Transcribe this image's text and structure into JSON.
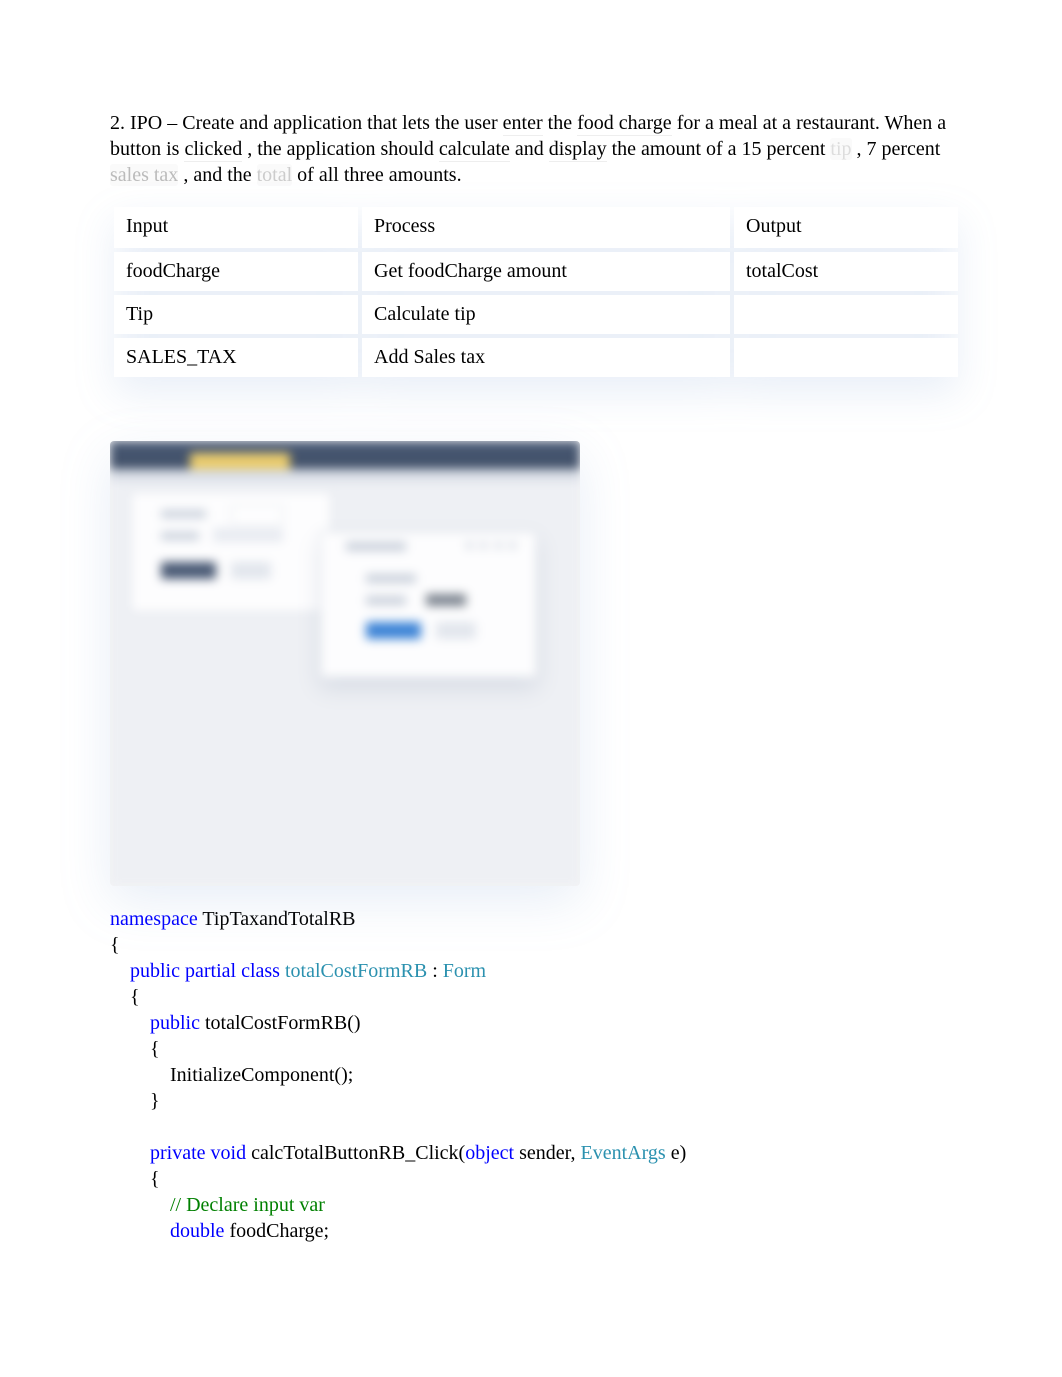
{
  "problem": {
    "prefix": "2. IPO – Create and application that lets the user ",
    "enter": "enter",
    "mid1": " the ",
    "foodcharge": "food charge",
    "mid2": " for a meal at a restaurant. When a button is ",
    "clicked": "clicked",
    "mid3": ", the application should ",
    "calculate": "calculate",
    "mid4": " and ",
    "display": "display",
    "mid5": " the amount of a 15 percent ",
    "tip": "tip",
    "mid6": ", 7 percent ",
    "salestax": "sales tax",
    "mid7": ", and the ",
    "total": "total",
    "mid8": " of all three amounts."
  },
  "ipo": {
    "headers": {
      "input": "Input",
      "process": "Process",
      "output": "Output"
    },
    "rows": [
      {
        "input": "foodCharge",
        "process": "Get foodCharge amount",
        "output": "totalCost"
      },
      {
        "input": "Tip",
        "process": "Calculate tip",
        "output": ""
      },
      {
        "input": "SALES_TAX",
        "process": "Add Sales tax",
        "output": ""
      }
    ]
  },
  "code": {
    "namespace_kw": "namespace",
    "namespace_name": " TipTaxandTotalRB",
    "open_brace": "{",
    "ppc": "public partial class ",
    "classname": "totalCostFormRB",
    "colon": " : ",
    "form": "Form",
    "open_brace2": "{",
    "public_kw": "public",
    "ctor_sig": " totalCostFormRB()",
    "open_brace3": "{",
    "init": "InitializeComponent();",
    "close_brace3": "}",
    "private_void": "private void",
    "method_name": " calcTotalButtonRB_Click(",
    "object_kw": "object",
    "sender": " sender, ",
    "eventargs": "EventArgs",
    "e_paren": " e)",
    "open_brace4": "{",
    "comment": "// Declare input var",
    "double_kw": "double",
    "foodcharge_decl": " foodCharge;"
  }
}
